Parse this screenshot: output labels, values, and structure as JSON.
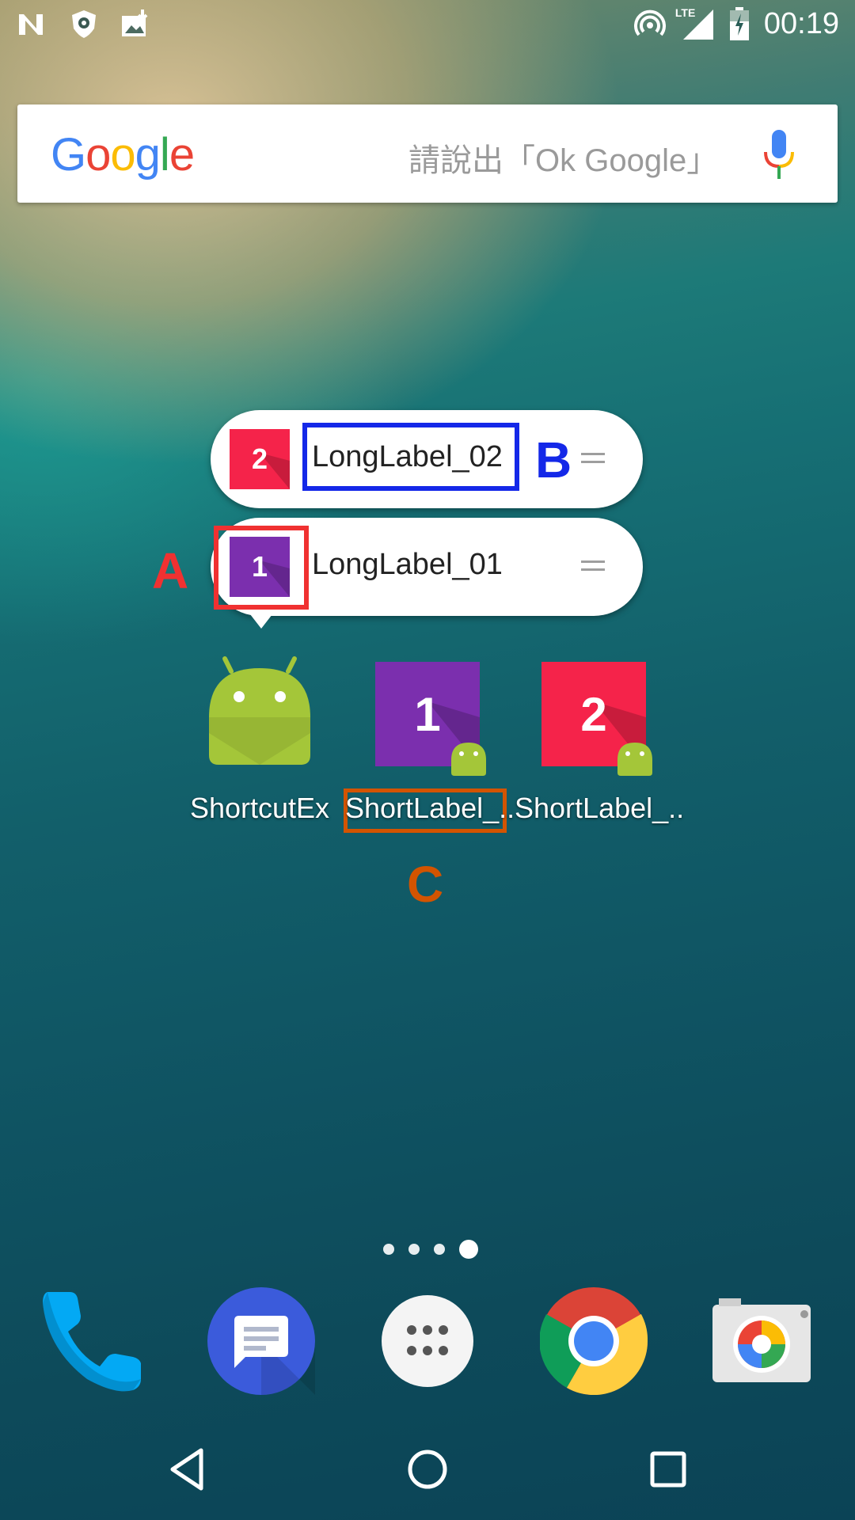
{
  "status_bar": {
    "icons": [
      "nfc-n-icon",
      "shield-icon",
      "download-photo-icon"
    ],
    "right_icons": [
      "hotspot-icon",
      "lte-signal-icon",
      "battery-charging-icon"
    ],
    "lte_text": "LTE",
    "time": "00:19"
  },
  "search": {
    "logo": "Google",
    "placeholder": "請說出「Ok Google」",
    "mic_icon": "mic-icon"
  },
  "shortcuts_popup": {
    "items": [
      {
        "number": "2",
        "label": "LongLabel_02",
        "color": "#f5234a"
      },
      {
        "number": "1",
        "label": "LongLabel_01",
        "color": "#7b2fae"
      }
    ]
  },
  "annotations": {
    "a": "A",
    "a_color": "#f03131",
    "b": "B",
    "b_color": "#1428e8",
    "c": "C",
    "c_color": "#d35400"
  },
  "home_icons": [
    {
      "label": "ShortcutEx"
    },
    {
      "label": "ShortLabel_..",
      "number": "1",
      "color": "#7b2fae"
    },
    {
      "label": "ShortLabel_..",
      "number": "2",
      "color": "#f5234a"
    }
  ],
  "dock": [
    "phone-icon",
    "messages-icon",
    "app-drawer-icon",
    "chrome-icon",
    "camera-icon"
  ],
  "nav": [
    "back-icon",
    "home-icon",
    "recents-icon"
  ]
}
